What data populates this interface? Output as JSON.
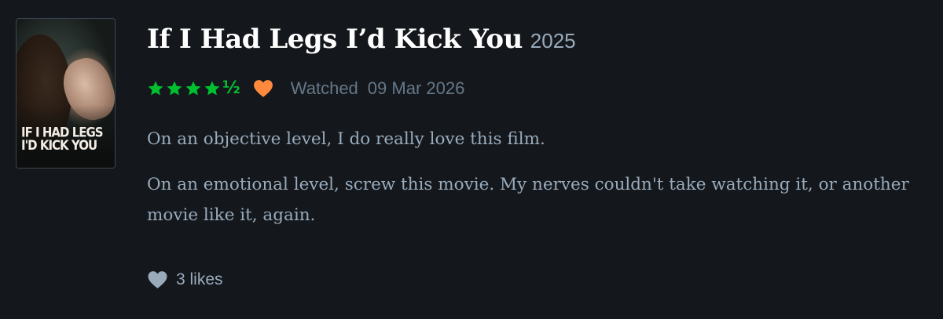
{
  "poster": {
    "title_lines": [
      "IF I HAD LEGS",
      "I'D KICK YOU"
    ]
  },
  "film": {
    "title": "If I Had Legs I’d Kick You",
    "year": "2025"
  },
  "rating": {
    "stars": 4.5,
    "full_star_icon": "star-icon",
    "half_label": "½",
    "star_color": "#00c030"
  },
  "liked": {
    "icon": "heart-icon",
    "color": "#ff8a3d"
  },
  "watched": {
    "label": "Watched",
    "date": "09 Mar 2026"
  },
  "review": {
    "paragraphs": [
      "On an objective level, I do really love this film.",
      "On an emotional level, screw this movie. My nerves couldn't take watching it, or another movie like it, again."
    ]
  },
  "likes": {
    "icon": "heart-icon",
    "label": "3 likes"
  },
  "colors": {
    "background": "#14181c",
    "title": "#ffffff",
    "muted": "#99aabb",
    "meta": "#667788",
    "body_text": "#99aabb"
  }
}
